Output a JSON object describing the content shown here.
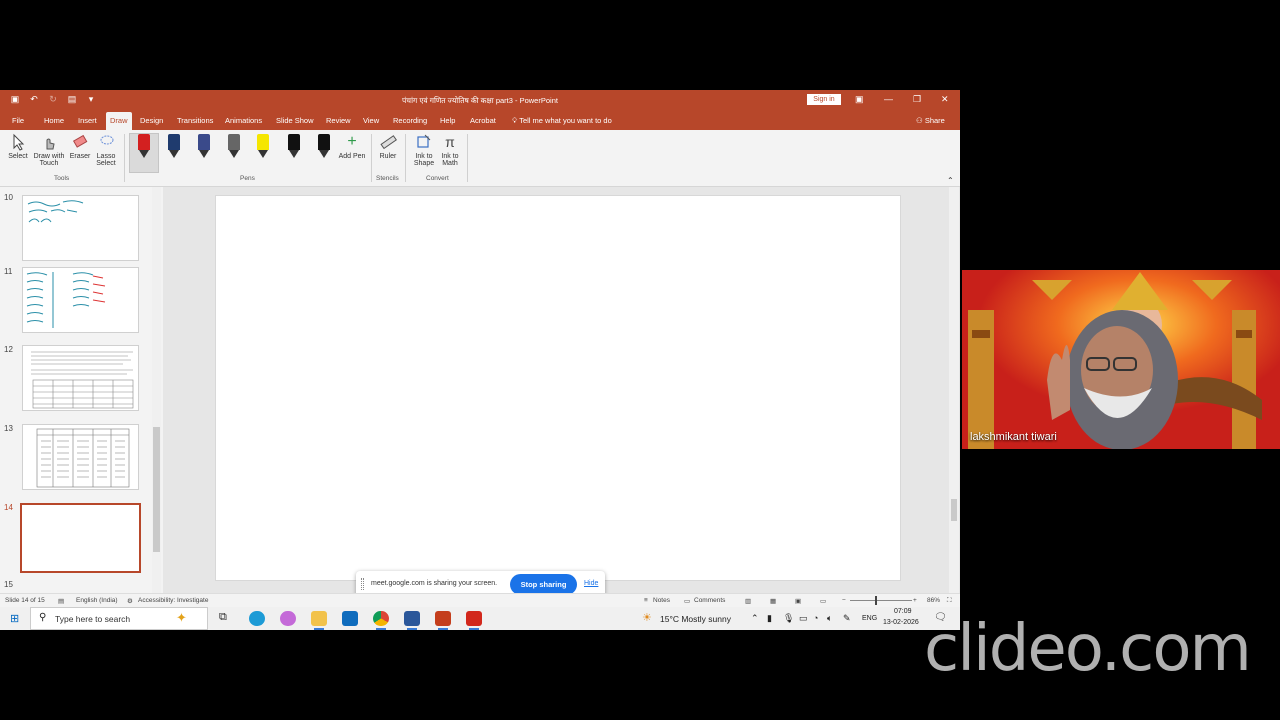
{
  "titlebar": {
    "title": "पंचांग एवं गणित ज्योतिष की कक्षा part3  -  PowerPoint",
    "signin": "Sign in"
  },
  "tabs": [
    "File",
    "Home",
    "Insert",
    "Draw",
    "Design",
    "Transitions",
    "Animations",
    "Slide Show",
    "Review",
    "View",
    "Recording",
    "Help",
    "Acrobat"
  ],
  "active_tab": "Draw",
  "tellme": "Tell me what you want to do",
  "share": "Share",
  "ribbon": {
    "tools": [
      "Select",
      "Draw with Touch",
      "Eraser",
      "Lasso Select"
    ],
    "tools_group": "Tools",
    "pens_group": "Pens",
    "add_pen": "Add Pen",
    "ruler": "Ruler",
    "stencils_group": "Stencils",
    "ink_to_shape": "Ink to Shape",
    "ink_to_math": "Ink to Math",
    "convert_group": "Convert",
    "pen_colors": [
      "#d32020",
      "#1f3b6e",
      "#3a4a8a",
      "#666666",
      "#f5e600",
      "#111111",
      "#111111"
    ]
  },
  "thumbnails": {
    "numbers": [
      "10",
      "11",
      "12",
      "13",
      "14"
    ],
    "active": "14",
    "partial_next": "15"
  },
  "share_banner": {
    "text": "meet.google.com is sharing your screen.",
    "stop": "Stop sharing",
    "hide": "Hide"
  },
  "statusbar": {
    "slide": "Slide 14 of 15",
    "language": "English (India)",
    "accessibility": "Accessibility: Investigate",
    "notes": "Notes",
    "comments": "Comments",
    "zoom": "86%"
  },
  "taskbar": {
    "search": "Type here to search",
    "weather": "15°C  Mostly sunny",
    "lang": "ENG",
    "time": "07:09",
    "date": "13-02-2026"
  },
  "video": {
    "name": "lakshmikant tiwari"
  },
  "watermark": "clideo.com"
}
